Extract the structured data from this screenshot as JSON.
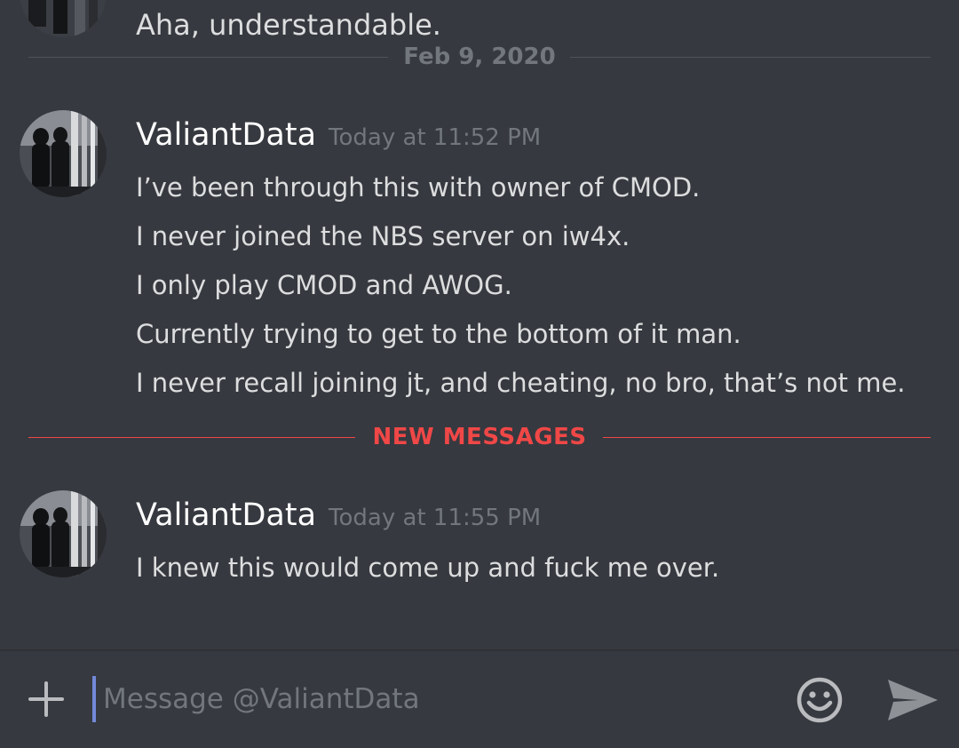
{
  "partial_message": {
    "text": "Aha, understandable."
  },
  "date_divider": {
    "label": "Feb 9, 2020"
  },
  "messages": [
    {
      "username": "ValiantData",
      "timestamp": "Today at 11:52 PM",
      "lines": [
        "I’ve been through this with owner of CMOD.",
        "I never joined the NBS server on iw4x.",
        "I only play CMOD and AWOG.",
        "Currently trying to get to the bottom of it man.",
        "I never recall joining jt, and cheating, no bro, that’s not me."
      ]
    },
    {
      "username": "ValiantData",
      "timestamp": "Today at 11:55 PM",
      "lines": [
        "I knew this would come up and fuck me over."
      ]
    }
  ],
  "new_messages_divider": {
    "label": "NEW MESSAGES"
  },
  "composer": {
    "placeholder": "Message @ValiantData",
    "value": "",
    "icons": {
      "add": "plus-icon",
      "emoji": "smiley-face-icon",
      "send": "send-arrow-icon"
    }
  },
  "colors": {
    "background": "#36393f",
    "username": "#ffffff",
    "text": "#dcddde",
    "muted": "#72767d",
    "new_messages": "#f04747",
    "cursor_accent": "#7289da"
  }
}
